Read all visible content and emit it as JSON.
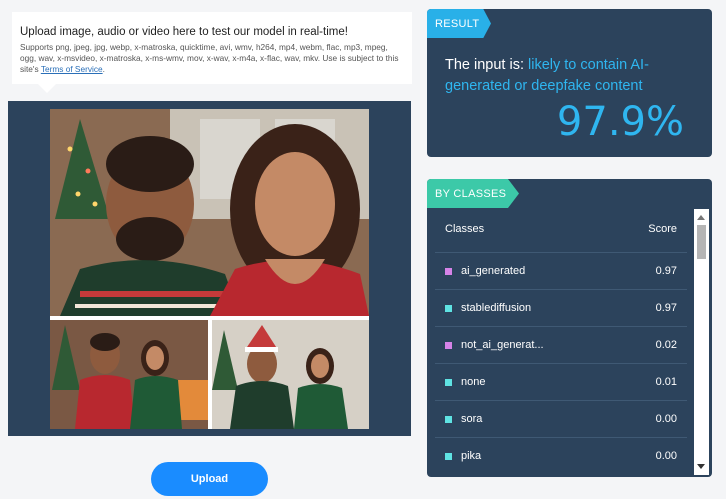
{
  "upload": {
    "title": "Upload image, audio or video here to test our model in real-time!",
    "supported": "Supports png, jpeg, jpg, webp, x-matroska, quicktime, avi, wmv, h264, mp4, webm, flac, mp3, mpeg, ogg, wav, x-msvideo, x-matroska, x-ms-wmv, mov, x-wav, x-m4a, x-flac, wav, mkv. Use is subject to this site's ",
    "terms_link": "Terms of Service",
    "terms_suffix": ".",
    "button_label": "Upload"
  },
  "result": {
    "tag": "RESULT",
    "prefix": "The input is: ",
    "verdict": "likely to contain AI-generated or deepfake content",
    "percentage": "97.9%"
  },
  "classes": {
    "tag": "BY CLASSES",
    "col_class": "Classes",
    "col_score": "Score",
    "rows": [
      {
        "name": "ai_generated",
        "score": "0.97",
        "color": "#d683e8"
      },
      {
        "name": "stablediffusion",
        "score": "0.97",
        "color": "#5fe3e3"
      },
      {
        "name": "not_ai_generat...",
        "score": "0.02",
        "color": "#d683e8"
      },
      {
        "name": "none",
        "score": "0.01",
        "color": "#5fe3e3"
      },
      {
        "name": "sora",
        "score": "0.00",
        "color": "#5fe3e3"
      },
      {
        "name": "pika",
        "score": "0.00",
        "color": "#5fe3e3"
      }
    ]
  },
  "colors": {
    "panel": "#2c435c",
    "accent_blue": "#2fb6f0",
    "accent_green": "#3cc9a8",
    "button": "#1a8cff"
  }
}
